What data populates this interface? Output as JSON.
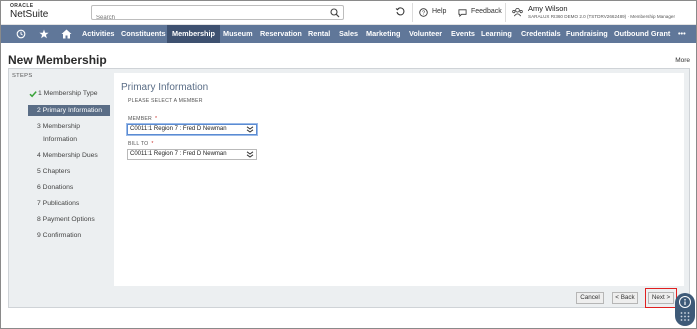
{
  "header": {
    "logo_top": "ORACLE",
    "logo_bottom": "NetSuite",
    "search_placeholder": "Search",
    "help_label": "Help",
    "feedback_label": "Feedback",
    "user_name": "Amy Wilson",
    "user_role": "SARALUX RI360 DEMO 2.0 (TSTDRV2662489) · Membership Manager"
  },
  "nav": {
    "items": [
      "Activities",
      "Constituents",
      "Membership",
      "Museum",
      "Reservation",
      "Rental",
      "Sales",
      "Marketing",
      "Volunteer",
      "Events",
      "Learning",
      "Credentials",
      "Fundraising",
      "Outbound Grant"
    ],
    "active": "Membership",
    "more_glyph": "•••"
  },
  "page": {
    "title": "New Membership",
    "more_label": "More"
  },
  "steps": {
    "heading": "STEPS",
    "items": [
      {
        "label": "1 Membership Type",
        "state": "done"
      },
      {
        "label": "2 Primary Information",
        "state": "active"
      },
      {
        "label": "3 Membership",
        "state": "todo"
      },
      {
        "label": "Information",
        "state": "todo"
      },
      {
        "label": "4 Membership Dues",
        "state": "todo"
      },
      {
        "label": "5 Chapters",
        "state": "todo"
      },
      {
        "label": "6 Donations",
        "state": "todo"
      },
      {
        "label": "7 Publications",
        "state": "todo"
      },
      {
        "label": "8 Payment Options",
        "state": "todo"
      },
      {
        "label": "9 Confirmation",
        "state": "todo"
      }
    ]
  },
  "form": {
    "section_title": "Primary Information",
    "instruction": "PLEASE SELECT A MEMBER",
    "member_label": "MEMBER",
    "member_value": "C0011:1 Region 7 : Fred D Newman",
    "bill_to_label": "BILL TO",
    "bill_to_value": "C0011:1 Region 7 : Fred D Newman",
    "required_mark": "*"
  },
  "footer": {
    "cancel_label": "Cancel",
    "back_label": "< Back",
    "next_label": "Next >"
  },
  "colors": {
    "nav_bg": "#607799",
    "nav_active": "#3e5170",
    "accent": "#5a6d86",
    "required": "#c8302b",
    "highlight": "#e02020"
  }
}
